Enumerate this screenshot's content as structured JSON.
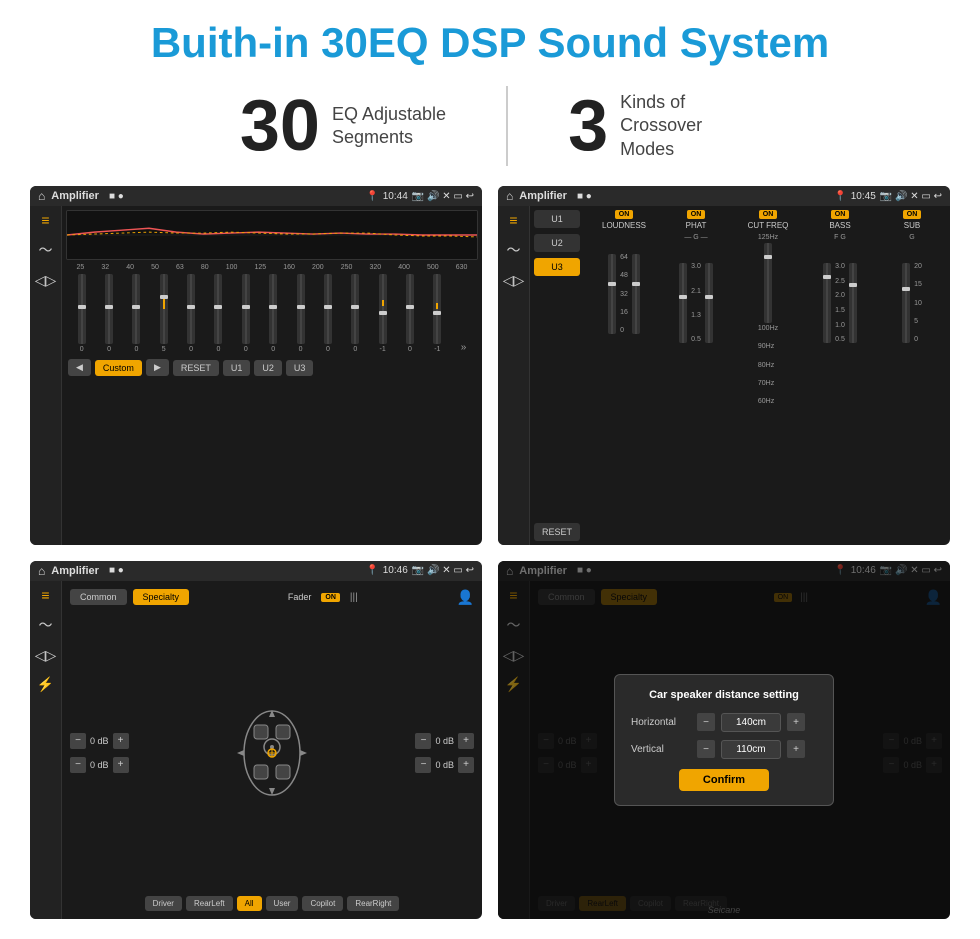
{
  "page": {
    "title": "Buith-in 30EQ DSP Sound System",
    "stat1_number": "30",
    "stat1_text_line1": "EQ Adjustable",
    "stat1_text_line2": "Segments",
    "stat2_number": "3",
    "stat2_text_line1": "Kinds of",
    "stat2_text_line2": "Crossover Modes"
  },
  "screen1": {
    "status_title": "Amplifier",
    "time": "10:44",
    "eq_labels": [
      "25",
      "32",
      "40",
      "50",
      "63",
      "80",
      "100",
      "125",
      "160",
      "200",
      "250",
      "320",
      "400",
      "500",
      "630"
    ],
    "eq_values": [
      "0",
      "0",
      "0",
      "0",
      "5",
      "0",
      "0",
      "0",
      "0",
      "0",
      "0",
      "0",
      "-1",
      "0",
      "-1"
    ],
    "bottom_buttons": [
      "◀",
      "Custom",
      "▶",
      "RESET",
      "U1",
      "U2",
      "U3"
    ]
  },
  "screen2": {
    "status_title": "Amplifier",
    "time": "10:45",
    "presets": [
      "U1",
      "U2",
      "U3"
    ],
    "active_preset": "U3",
    "sections": [
      {
        "label": "LOUDNESS",
        "on": true
      },
      {
        "label": "PHAT",
        "on": true
      },
      {
        "label": "CUT FREQ",
        "on": true
      },
      {
        "label": "BASS",
        "on": true
      },
      {
        "label": "SUB",
        "on": true
      }
    ],
    "reset_label": "RESET"
  },
  "screen3": {
    "status_title": "Amplifier",
    "time": "10:46",
    "tabs": [
      "Common",
      "Specialty"
    ],
    "active_tab": "Specialty",
    "fader_label": "Fader",
    "fader_on": true,
    "db_rows": [
      {
        "value": "0 dB"
      },
      {
        "value": "0 dB"
      },
      {
        "value": "0 dB"
      },
      {
        "value": "0 dB"
      }
    ],
    "speaker_buttons": [
      "Driver",
      "RearLeft",
      "All",
      "User",
      "Copilot",
      "RearRight"
    ]
  },
  "screen4": {
    "status_title": "Amplifier",
    "time": "10:46",
    "tabs": [
      "Common",
      "Specialty"
    ],
    "active_tab": "Specialty",
    "dialog": {
      "title": "Car speaker distance setting",
      "horizontal_label": "Horizontal",
      "horizontal_value": "140cm",
      "vertical_label": "Vertical",
      "vertical_value": "110cm",
      "confirm_label": "Confirm"
    },
    "speaker_buttons": [
      "Driver",
      "RearLeft",
      "Copilot",
      "RearRight"
    ]
  },
  "watermark": "Seicane"
}
